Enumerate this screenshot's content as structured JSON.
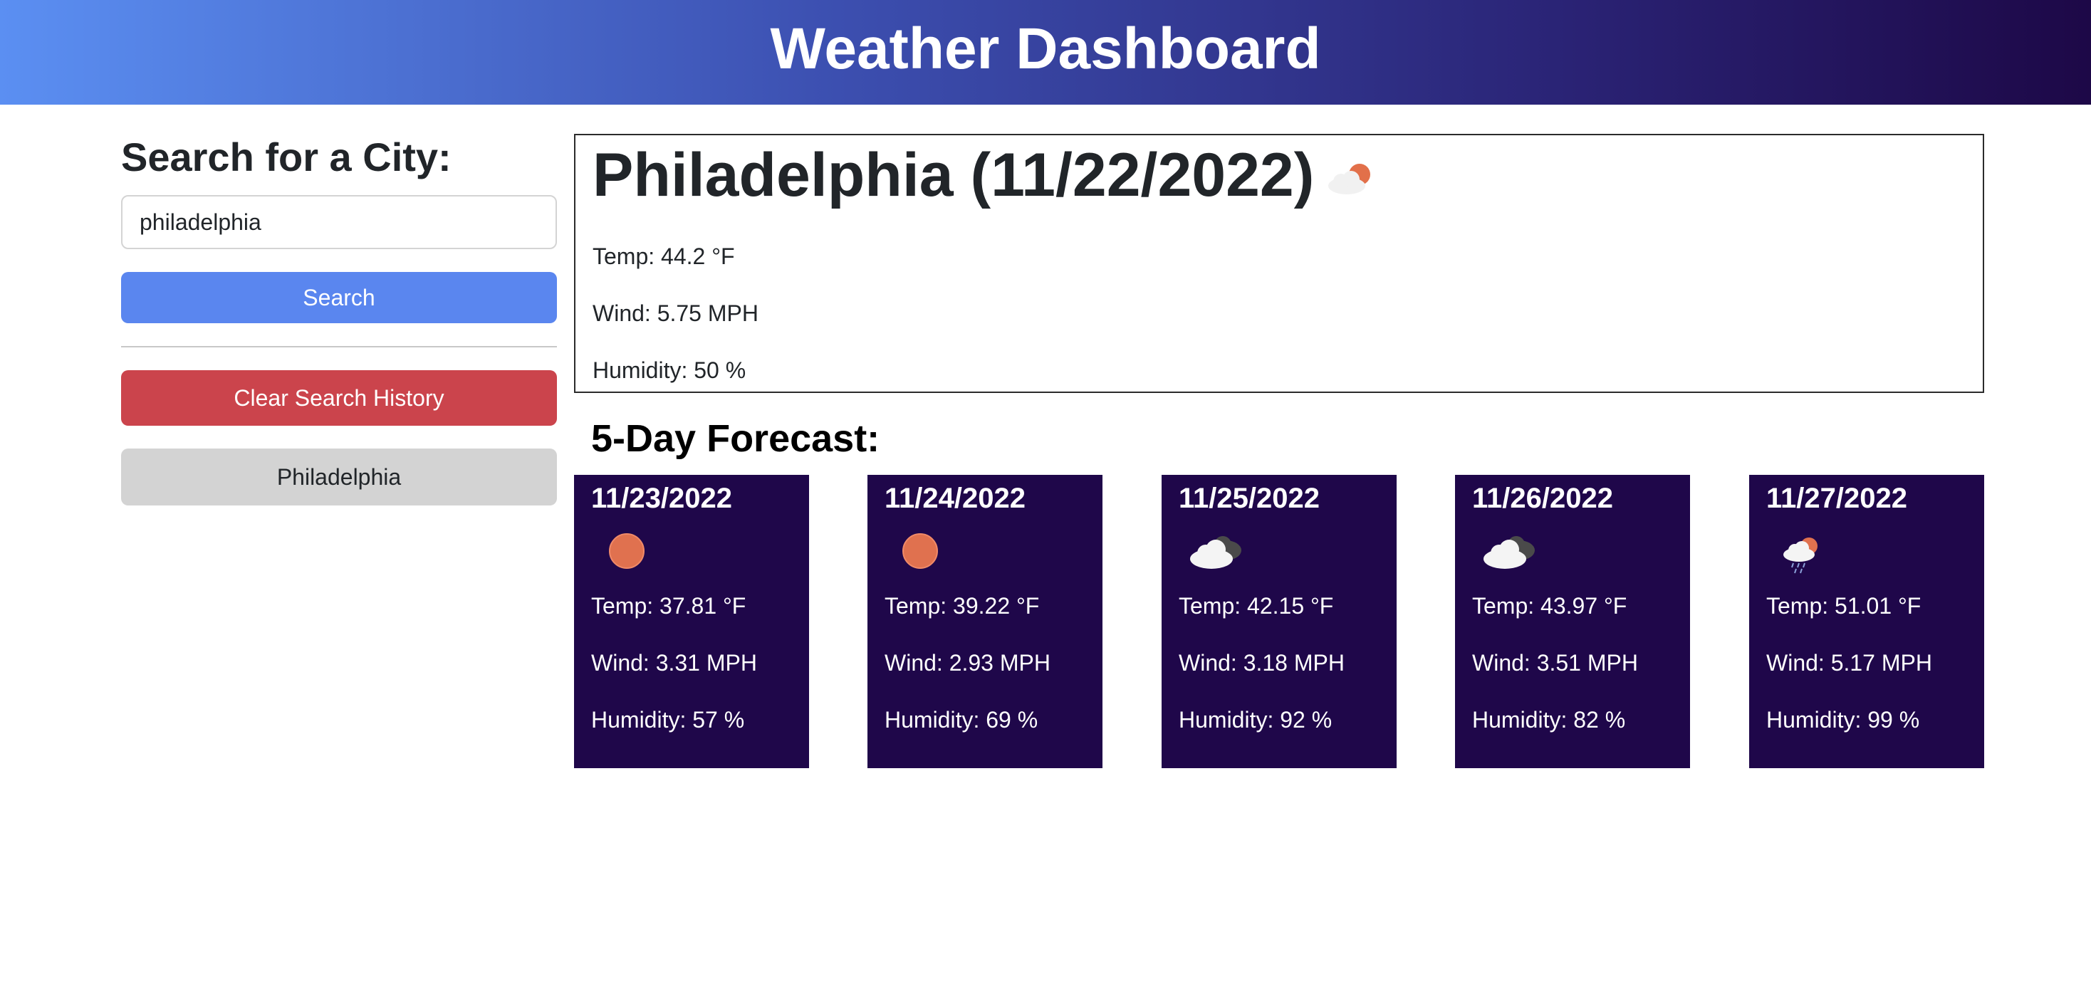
{
  "header": {
    "title": "Weather Dashboard"
  },
  "sidebar": {
    "heading": "Search for a City:",
    "search_value": "philadelphia",
    "search_button": "Search",
    "clear_button": "Clear Search History",
    "history": [
      "Philadelphia"
    ]
  },
  "current": {
    "title": "Philadelphia (11/22/2022)",
    "icon": "partly-cloudy-icon",
    "temp": "Temp: 44.2 °F",
    "wind": "Wind: 5.75 MPH",
    "humidity": "Humidity: 50 %"
  },
  "forecast": {
    "heading": "5-Day Forecast:",
    "days": [
      {
        "date": "11/23/2022",
        "icon": "sun-icon",
        "temp": "Temp: 37.81 °F",
        "wind": "Wind: 3.31 MPH",
        "humidity": "Humidity: 57 %"
      },
      {
        "date": "11/24/2022",
        "icon": "sun-icon",
        "temp": "Temp: 39.22 °F",
        "wind": "Wind: 2.93 MPH",
        "humidity": "Humidity: 69 %"
      },
      {
        "date": "11/25/2022",
        "icon": "cloudy-icon",
        "temp": "Temp: 42.15 °F",
        "wind": "Wind: 3.18 MPH",
        "humidity": "Humidity: 92 %"
      },
      {
        "date": "11/26/2022",
        "icon": "cloudy-icon",
        "temp": "Temp: 43.97 °F",
        "wind": "Wind: 3.51 MPH",
        "humidity": "Humidity: 82 %"
      },
      {
        "date": "11/27/2022",
        "icon": "rain-sun-icon",
        "temp": "Temp: 51.01 °F",
        "wind": "Wind: 5.17 MPH",
        "humidity": "Humidity: 99 %"
      }
    ]
  },
  "colors": {
    "header_gradient_start": "#5b8ff2",
    "header_gradient_end": "#1d0847",
    "search_button": "#5a86ef",
    "clear_button": "#cb444c",
    "history_button": "#d3d3d3",
    "forecast_card": "#1f074a"
  }
}
